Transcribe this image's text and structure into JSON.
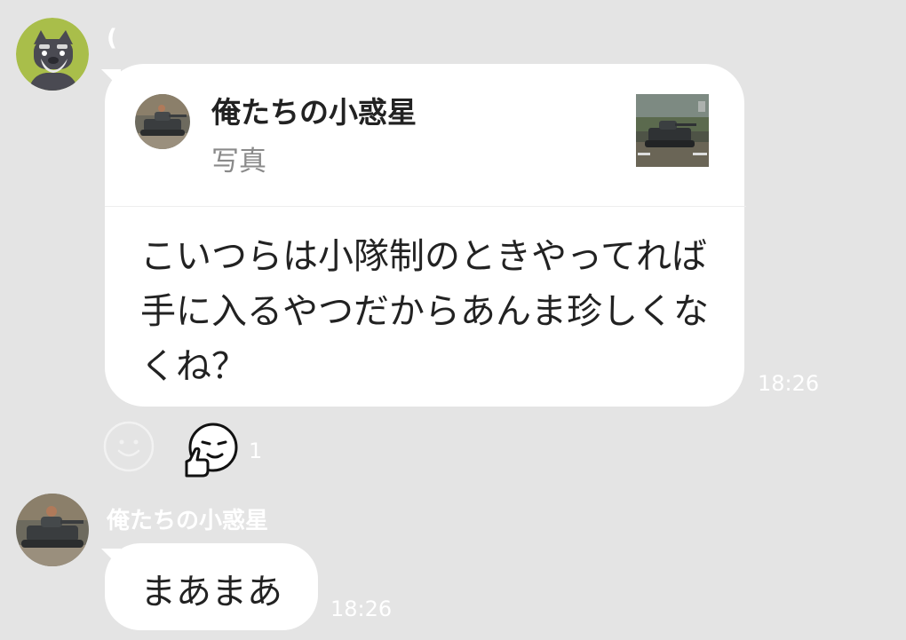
{
  "messages": [
    {
      "sender_name": "(",
      "avatar_icon": "schnauzer-dog-icon",
      "reply_to": {
        "name": "俺たちの小惑星",
        "type": "写真",
        "avatar_icon": "tank-avatar-icon",
        "thumbnail_icon": "tank-photo-thumbnail"
      },
      "text": "こいつらは小隊制のときやってれば手に入るやつだからあんま珍しくなくね？",
      "time": "18:26",
      "reaction": {
        "add_icon": "smiley-add-reaction-icon",
        "sticker_icon": "thumbs-up-face-sticker-icon",
        "count": "1"
      }
    },
    {
      "sender_name": "俺たちの小惑星",
      "avatar_icon": "tank-avatar-icon",
      "text": "まあまあ",
      "time": "18:26"
    }
  ],
  "colors": {
    "background": "#e4e4e4",
    "bubble": "#ffffff",
    "text": "#222222",
    "subtext": "#8a8a8a",
    "avatar_green": "#a9be4a"
  }
}
